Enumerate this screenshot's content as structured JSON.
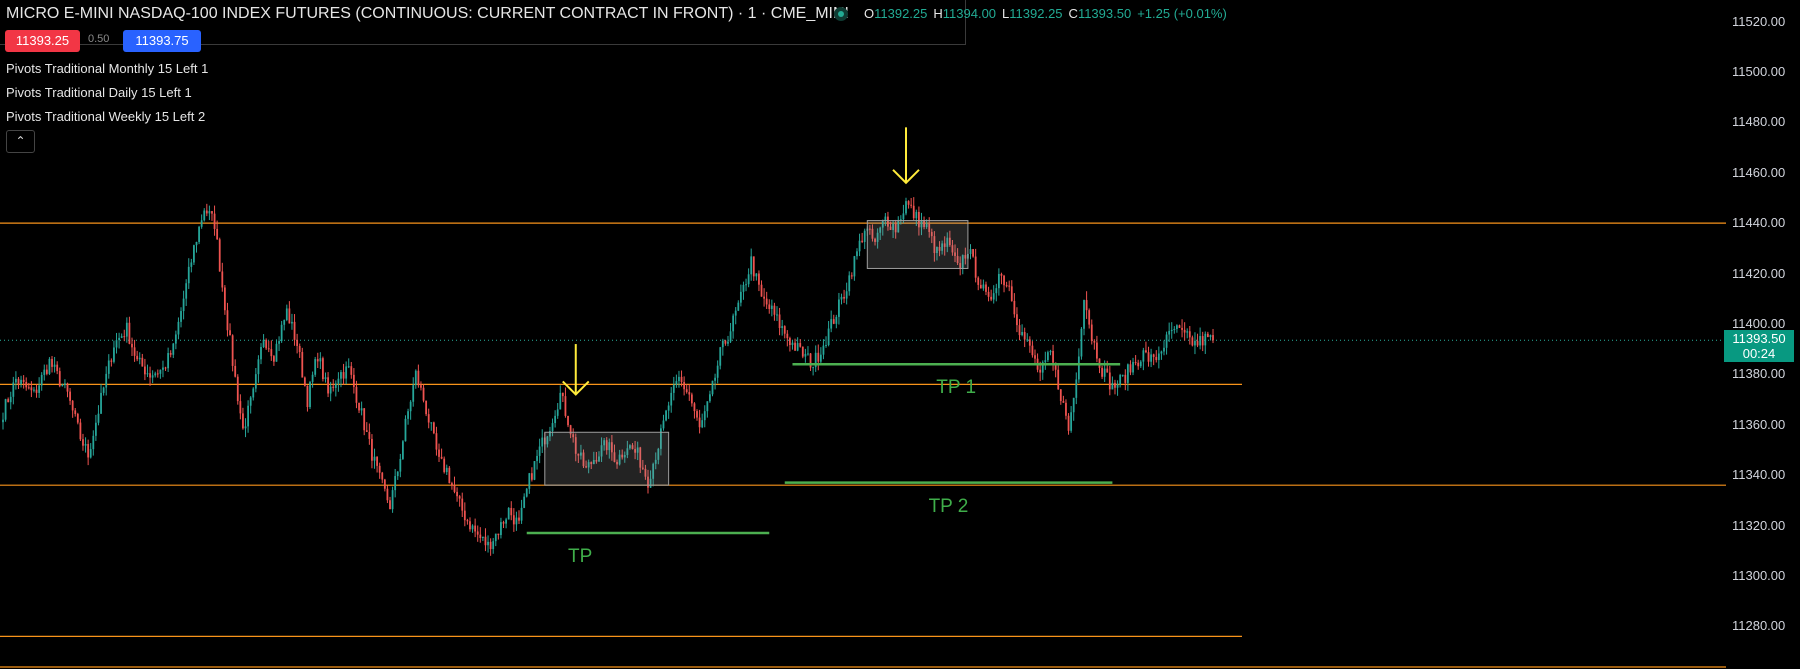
{
  "header": {
    "title": "MICRO E-MINI NASDAQ-100 INDEX FUTURES (CONTINUOUS: CURRENT CONTRACT IN FRONT) · 1 · CME_MINI",
    "ohlc": {
      "o_label": "O",
      "o": "11392.25",
      "h_label": "H",
      "h": "11394.00",
      "l_label": "L",
      "l": "11392.25",
      "c_label": "C",
      "c": "11393.50",
      "change": "+1.25 (+0.01%)"
    },
    "bid": "11393.25",
    "spread": "0.50",
    "ask": "11393.75"
  },
  "indicators": [
    "Pivots Traditional Monthly 15 Left 1",
    "Pivots Traditional Daily 15 Left 1",
    "Pivots Traditional Weekly 15 Left 2"
  ],
  "collapse_icon": "chevron-up-icon",
  "current_price": {
    "price": "11393.50",
    "countdown": "00:24"
  },
  "colors": {
    "up": "#26a69a",
    "down": "#ef5350",
    "pivot": "#f7931a",
    "target": "#4caf50",
    "arrow": "#ffeb3b",
    "box": "#9e9e9e"
  },
  "chart_data": {
    "type": "candlestick",
    "y_axis": {
      "ticks": [
        "11520.00",
        "11500.00",
        "11480.00",
        "11460.00",
        "11440.00",
        "11420.00",
        "11400.00",
        "11380.00",
        "11360.00",
        "11340.00",
        "11320.00",
        "11300.00",
        "11280.00"
      ],
      "range": [
        11262,
        11528
      ]
    },
    "path_keypoints": [
      [
        0,
        11365
      ],
      [
        5,
        11378
      ],
      [
        12,
        11372
      ],
      [
        18,
        11385
      ],
      [
        25,
        11372
      ],
      [
        30,
        11355
      ],
      [
        33,
        11348
      ],
      [
        38,
        11370
      ],
      [
        43,
        11392
      ],
      [
        48,
        11398
      ],
      [
        52,
        11385
      ],
      [
        57,
        11380
      ],
      [
        62,
        11382
      ],
      [
        66,
        11390
      ],
      [
        70,
        11410
      ],
      [
        74,
        11430
      ],
      [
        78,
        11446
      ],
      [
        82,
        11440
      ],
      [
        85,
        11415
      ],
      [
        89,
        11385
      ],
      [
        93,
        11358
      ],
      [
        97,
        11372
      ],
      [
        101,
        11395
      ],
      [
        105,
        11388
      ],
      [
        110,
        11405
      ],
      [
        114,
        11392
      ],
      [
        118,
        11370
      ],
      [
        122,
        11388
      ],
      [
        126,
        11372
      ],
      [
        130,
        11380
      ],
      [
        134,
        11382
      ],
      [
        138,
        11368
      ],
      [
        142,
        11352
      ],
      [
        146,
        11338
      ],
      [
        150,
        11328
      ],
      [
        153,
        11342
      ],
      [
        156,
        11360
      ],
      [
        160,
        11380
      ],
      [
        163,
        11370
      ],
      [
        166,
        11358
      ],
      [
        169,
        11345
      ],
      [
        172,
        11342
      ],
      [
        176,
        11330
      ],
      [
        180,
        11322
      ],
      [
        184,
        11316
      ],
      [
        188,
        11312
      ],
      [
        192,
        11318
      ],
      [
        196,
        11326
      ],
      [
        200,
        11320
      ],
      [
        204,
        11338
      ],
      [
        208,
        11350
      ],
      [
        212,
        11360
      ],
      [
        216,
        11372
      ],
      [
        219,
        11362
      ],
      [
        222,
        11350
      ],
      [
        226,
        11342
      ],
      [
        230,
        11348
      ],
      [
        234,
        11352
      ],
      [
        238,
        11346
      ],
      [
        242,
        11352
      ],
      [
        246,
        11348
      ],
      [
        250,
        11338
      ],
      [
        254,
        11352
      ],
      [
        258,
        11368
      ],
      [
        262,
        11378
      ],
      [
        266,
        11372
      ],
      [
        270,
        11358
      ],
      [
        274,
        11370
      ],
      [
        278,
        11388
      ],
      [
        282,
        11398
      ],
      [
        286,
        11410
      ],
      [
        290,
        11425
      ],
      [
        294,
        11410
      ],
      [
        298,
        11405
      ],
      [
        302,
        11398
      ],
      [
        306,
        11392
      ],
      [
        310,
        11388
      ],
      [
        314,
        11384
      ],
      [
        318,
        11392
      ],
      [
        322,
        11402
      ],
      [
        326,
        11412
      ],
      [
        330,
        11425
      ],
      [
        334,
        11438
      ],
      [
        338,
        11432
      ],
      [
        342,
        11442
      ],
      [
        346,
        11438
      ],
      [
        350,
        11448
      ],
      [
        354,
        11442
      ],
      [
        358,
        11438
      ],
      [
        362,
        11428
      ],
      [
        366,
        11432
      ],
      [
        370,
        11422
      ],
      [
        374,
        11430
      ],
      [
        378,
        11418
      ],
      [
        382,
        11408
      ],
      [
        386,
        11420
      ],
      [
        390,
        11415
      ],
      [
        394,
        11398
      ],
      [
        398,
        11390
      ],
      [
        402,
        11380
      ],
      [
        406,
        11388
      ],
      [
        410,
        11372
      ],
      [
        413,
        11358
      ],
      [
        416,
        11378
      ],
      [
        419,
        11412
      ],
      [
        422,
        11395
      ],
      [
        426,
        11382
      ],
      [
        430,
        11375
      ],
      [
        434,
        11378
      ],
      [
        438,
        11384
      ],
      [
        442,
        11388
      ],
      [
        446,
        11385
      ],
      [
        450,
        11392
      ],
      [
        454,
        11398
      ],
      [
        458,
        11395
      ],
      [
        462,
        11392
      ],
      [
        466,
        11394
      ],
      [
        469,
        11393.5
      ]
    ],
    "pivot_levels": [
      {
        "price": 11440,
        "extends": "full"
      },
      {
        "price": 11376,
        "extends": "partial"
      },
      {
        "price": 11336,
        "extends": "full"
      },
      {
        "price": 11276,
        "extends": "partial"
      },
      {
        "price": 11263,
        "extends": "full"
      }
    ],
    "current_price": 11393.5,
    "consolidation_boxes": [
      {
        "bar_from": 210,
        "bar_to": 258,
        "price_low": 11336,
        "price_high": 11357
      },
      {
        "bar_from": 335,
        "bar_to": 374,
        "price_low": 11422,
        "price_high": 11441
      }
    ],
    "arrows": [
      {
        "bar": 222,
        "price_from": 11392,
        "price_to": 11372
      },
      {
        "bar": 350,
        "price_from": 11478,
        "price_to": 11456
      }
    ],
    "targets": [
      {
        "label": "TP",
        "bar_from": 203,
        "bar_to": 297,
        "price": 11317
      },
      {
        "label": "TP 1",
        "bar_from": 306,
        "bar_to": 433,
        "price": 11384
      },
      {
        "label": "TP 2",
        "bar_from": 303,
        "bar_to": 430,
        "price": 11337
      }
    ]
  }
}
